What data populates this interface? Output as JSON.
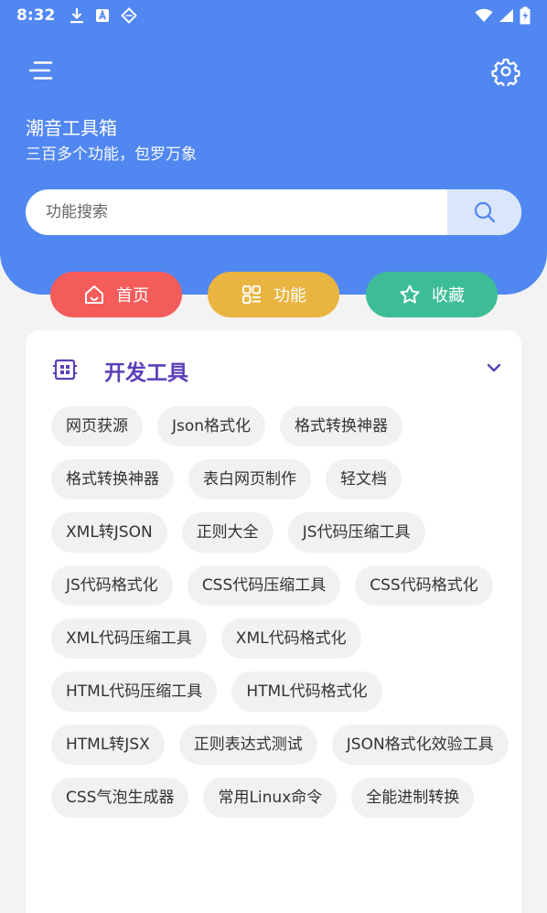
{
  "status_bar": {
    "time": "8:32"
  },
  "header": {
    "app_title": "潮音工具箱",
    "subtitle": "三百多个功能，包罗万象"
  },
  "search": {
    "placeholder": "功能搜索"
  },
  "nav": {
    "home": "首页",
    "functions": "功能",
    "favorites": "收藏"
  },
  "colors": {
    "primary": "#5187f0",
    "home": "#f45c5a",
    "functions": "#e9b440",
    "favorites": "#3dbd96",
    "section_title": "#5b3fb8"
  },
  "section": {
    "title": "开发工具",
    "icon": "chip-icon",
    "expanded_icon": "chevron-down-icon",
    "tools": [
      "网页获源",
      "Json格式化",
      "格式转换神器",
      "格式转换神器",
      "表白网页制作",
      "轻文档",
      "XML转JSON",
      "正则大全",
      "JS代码压缩工具",
      "JS代码格式化",
      "CSS代码压缩工具",
      "CSS代码格式化",
      "XML代码压缩工具",
      "XML代码格式化",
      "HTML代码压缩工具",
      "HTML代码格式化",
      "HTML转JSX",
      "正则表达式测试",
      "JSON格式化效验工具",
      "CSS气泡生成器",
      "常用Linux命令",
      "全能进制转换"
    ]
  }
}
